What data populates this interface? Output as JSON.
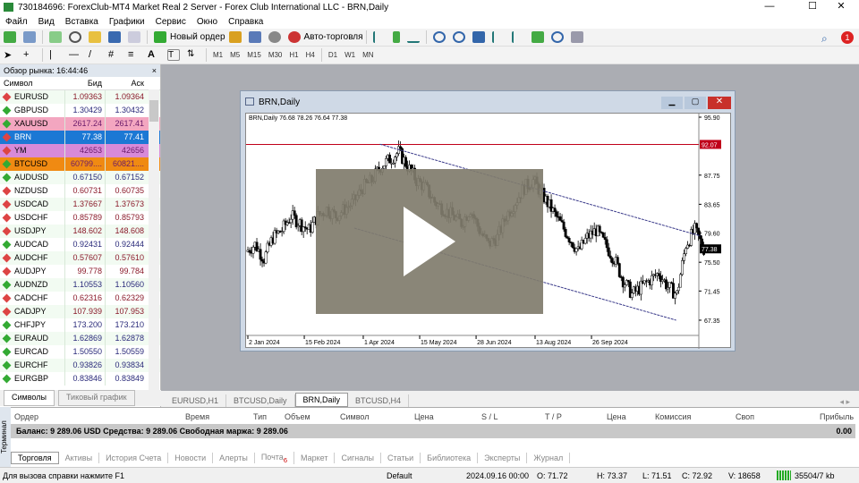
{
  "window": {
    "title": "730184696: ForexClub-MT4 Market Real 2 Server - Forex Club International LLC - BRN,Daily",
    "minimize": "—",
    "maximize": "☐",
    "close": "✕"
  },
  "menu": [
    "Файл",
    "Вид",
    "Вставка",
    "Графики",
    "Сервис",
    "Окно",
    "Справка"
  ],
  "toolbar": {
    "new_order": "Новый ордер",
    "autotrade": "Авто-торговля",
    "notif_count": "1",
    "timeframes": [
      "M1",
      "M5",
      "M15",
      "M30",
      "H1",
      "H4",
      "D1",
      "W1",
      "MN"
    ]
  },
  "market_watch": {
    "title": "Обзор рынка: 16:44:46",
    "close": "×",
    "columns": [
      "Символ",
      "Бид",
      "Аск"
    ],
    "rows": [
      {
        "symbol": "EURUSD",
        "bid": "1.09363",
        "ask": "1.09364",
        "dir": "down"
      },
      {
        "symbol": "GBPUSD",
        "bid": "1.30429",
        "ask": "1.30432",
        "dir": "up"
      },
      {
        "symbol": "XAUUSD",
        "bid": "2617.24",
        "ask": "2617.41",
        "dir": "up",
        "hl": "#f3a6c0"
      },
      {
        "symbol": "BRN",
        "bid": "77.38",
        "ask": "77.41",
        "dir": "down",
        "hl": "#1c78d4"
      },
      {
        "symbol": "YM",
        "bid": "42653",
        "ask": "42656",
        "dir": "down",
        "hl": "#d88ad8"
      },
      {
        "symbol": "BTCUSD",
        "bid": "60799....",
        "ask": "60821....",
        "dir": "up",
        "hl": "#f08a12"
      },
      {
        "symbol": "AUDUSD",
        "bid": "0.67150",
        "ask": "0.67152",
        "dir": "up"
      },
      {
        "symbol": "NZDUSD",
        "bid": "0.60731",
        "ask": "0.60735",
        "dir": "down"
      },
      {
        "symbol": "USDCAD",
        "bid": "1.37667",
        "ask": "1.37673",
        "dir": "down"
      },
      {
        "symbol": "USDCHF",
        "bid": "0.85789",
        "ask": "0.85793",
        "dir": "down"
      },
      {
        "symbol": "USDJPY",
        "bid": "148.602",
        "ask": "148.608",
        "dir": "down"
      },
      {
        "symbol": "AUDCAD",
        "bid": "0.92431",
        "ask": "0.92444",
        "dir": "up"
      },
      {
        "symbol": "AUDCHF",
        "bid": "0.57607",
        "ask": "0.57610",
        "dir": "down"
      },
      {
        "symbol": "AUDJPY",
        "bid": "99.778",
        "ask": "99.784",
        "dir": "down"
      },
      {
        "symbol": "AUDNZD",
        "bid": "1.10553",
        "ask": "1.10560",
        "dir": "up"
      },
      {
        "symbol": "CADCHF",
        "bid": "0.62316",
        "ask": "0.62329",
        "dir": "down"
      },
      {
        "symbol": "CADJPY",
        "bid": "107.939",
        "ask": "107.953",
        "dir": "down"
      },
      {
        "symbol": "CHFJPY",
        "bid": "173.200",
        "ask": "173.210",
        "dir": "up"
      },
      {
        "symbol": "EURAUD",
        "bid": "1.62869",
        "ask": "1.62878",
        "dir": "up"
      },
      {
        "symbol": "EURCAD",
        "bid": "1.50550",
        "ask": "1.50559",
        "dir": "up"
      },
      {
        "symbol": "EURCHF",
        "bid": "0.93826",
        "ask": "0.93834",
        "dir": "up"
      },
      {
        "symbol": "EURGBP",
        "bid": "0.83846",
        "ask": "0.83849",
        "dir": "up"
      }
    ],
    "tabs": [
      "Символы",
      "Тиковый график"
    ]
  },
  "chart_window": {
    "title": "BRN,Daily",
    "legend": "BRN,Daily  76.68 78.26 76.64 77.38",
    "price_ticks": [
      "95.90",
      "87.75",
      "83.65",
      "79.60",
      "75.50",
      "71.45",
      "67.35"
    ],
    "price_tick_values": [
      95.9,
      87.75,
      83.65,
      79.6,
      75.5,
      71.45,
      67.35
    ],
    "hline_label": "92.07",
    "hline_value": 92.07,
    "current_label": "77.38",
    "current_value": 77.38,
    "date_ticks": [
      "2 Jan 2024",
      "15 Feb 2024",
      "1 Apr 2024",
      "15 May 2024",
      "28 Jun 2024",
      "13 Aug 2024",
      "26 Sep 2024"
    ],
    "date_tick_days": [
      0,
      44,
      90,
      134,
      178,
      224,
      268
    ],
    "weekly_closes": [
      77,
      78,
      76,
      79,
      80,
      82,
      81,
      80,
      82,
      83,
      82,
      83,
      84,
      86,
      87,
      89,
      90,
      91,
      89,
      87,
      86,
      84,
      83,
      82,
      81,
      83,
      80,
      78,
      79,
      82,
      84,
      86,
      87,
      85,
      83,
      81,
      79,
      77,
      79,
      80,
      78,
      76,
      73,
      71,
      72,
      73,
      74,
      72,
      71,
      78,
      80,
      77.38
    ],
    "trendlines": [
      {
        "from": [
          103,
          92.1
        ],
        "to": [
          353,
          79.2
        ]
      },
      {
        "from": [
          83,
          80.3
        ],
        "to": [
          334,
          67.35
        ]
      }
    ],
    "colors": {
      "hline": "#c0001a",
      "trend": "#3a3a8a"
    }
  },
  "chart_tabs": [
    "EURUSD,H1",
    "BTCUSD,Daily",
    "BRN,Daily",
    "BTCUSD,H4"
  ],
  "terminal": {
    "label": "Терминал",
    "columns": [
      "Ордер",
      "Время",
      "Тип",
      "Объем",
      "Символ",
      "Цена",
      "S / L",
      "T / P",
      "Цена",
      "Комиссия",
      "Своп",
      "Прибыль"
    ],
    "balance": "Баланс: 9 289.06 USD  Средства: 9 289.06  Свободная маржа: 9 289.06",
    "profit": "0.00",
    "tabs": [
      "Торговля",
      "Активы",
      "История Счета",
      "Новости",
      "Алерты",
      "Почта",
      "Маркет",
      "Сигналы",
      "Статьи",
      "Библиотека",
      "Эксперты",
      "Журнал"
    ],
    "mail_badge": "6"
  },
  "status": {
    "help": "Для вызова справки нажмите F1",
    "profile": "Default",
    "datetime": "2024.09.16 00:00",
    "open": "O: 71.72",
    "high": "H: 73.37",
    "low": "L: 71.51",
    "close": "C: 72.92",
    "volume": "V: 18658",
    "traffic": "35504/7 kb"
  }
}
